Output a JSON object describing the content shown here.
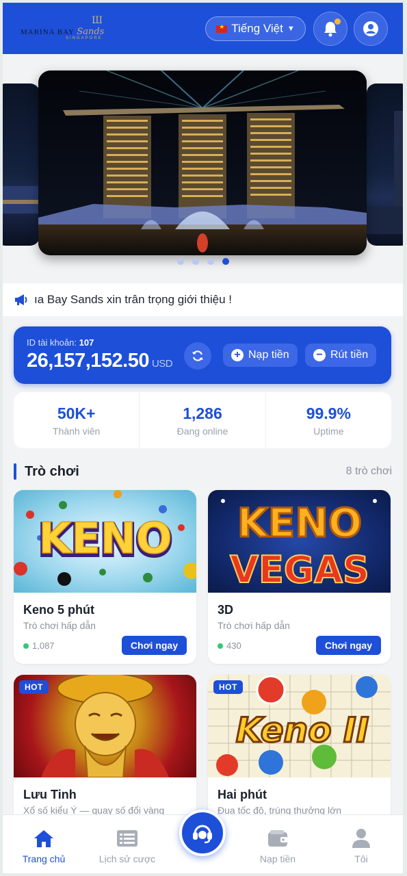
{
  "header": {
    "logo_text": "MARINA BAY Sands",
    "logo_sub": "SINGAPORE",
    "language": "Tiếng Việt"
  },
  "carousel": {
    "slides": 4,
    "active_index": 3
  },
  "announcement": {
    "text": "ıa Bay Sands xin trân trọng giới thiệu !"
  },
  "account": {
    "id_label": "ID tài khoản:",
    "id_value": "107",
    "balance": "26,157,152.50",
    "currency": "USD",
    "deposit_label": "Nạp tiền",
    "withdraw_label": "Rút tiền"
  },
  "stats": [
    {
      "value": "50K+",
      "label": "Thành viên"
    },
    {
      "value": "1,286",
      "label": "Đang online"
    },
    {
      "value": "99.9%",
      "label": "Uptime"
    }
  ],
  "games_section": {
    "title": "Trò chơi",
    "count_label": "8 trò chơi"
  },
  "games": [
    {
      "name": "Keno 5 phút",
      "desc": "Trò chơi hấp dẫn",
      "players": "1,087",
      "play_label": "Chơi ngay",
      "thumb_text": "KENO"
    },
    {
      "name": "3D",
      "desc": "Trò chơi hấp dẫn",
      "players": "430",
      "play_label": "Chơi ngay",
      "thumb_text_1": "KENO",
      "thumb_text_2": "VEGAS"
    },
    {
      "name": "Lưu Tinh",
      "desc": "Xổ số kiểu Ý — quay số đổi vàng",
      "badge": "HOT"
    },
    {
      "name": "Hai phút",
      "desc": "Đua tốc độ, trúng thưởng lớn",
      "badge": "HOT",
      "thumb_text": "Keno II"
    }
  ],
  "nav": [
    {
      "label": "Trang chủ",
      "icon": "home-icon",
      "active": true
    },
    {
      "label": "Lịch sử cược",
      "icon": "list-icon",
      "active": false
    },
    {
      "label": "",
      "icon": "headset-icon",
      "active": false
    },
    {
      "label": "Nạp tiền",
      "icon": "wallet-icon",
      "active": false
    },
    {
      "label": "Tôi",
      "icon": "user-icon",
      "active": false
    }
  ],
  "colors": {
    "primary": "#1d4fd8",
    "online_dot": "#2ecc71",
    "bell_dot": "#f7b731"
  }
}
